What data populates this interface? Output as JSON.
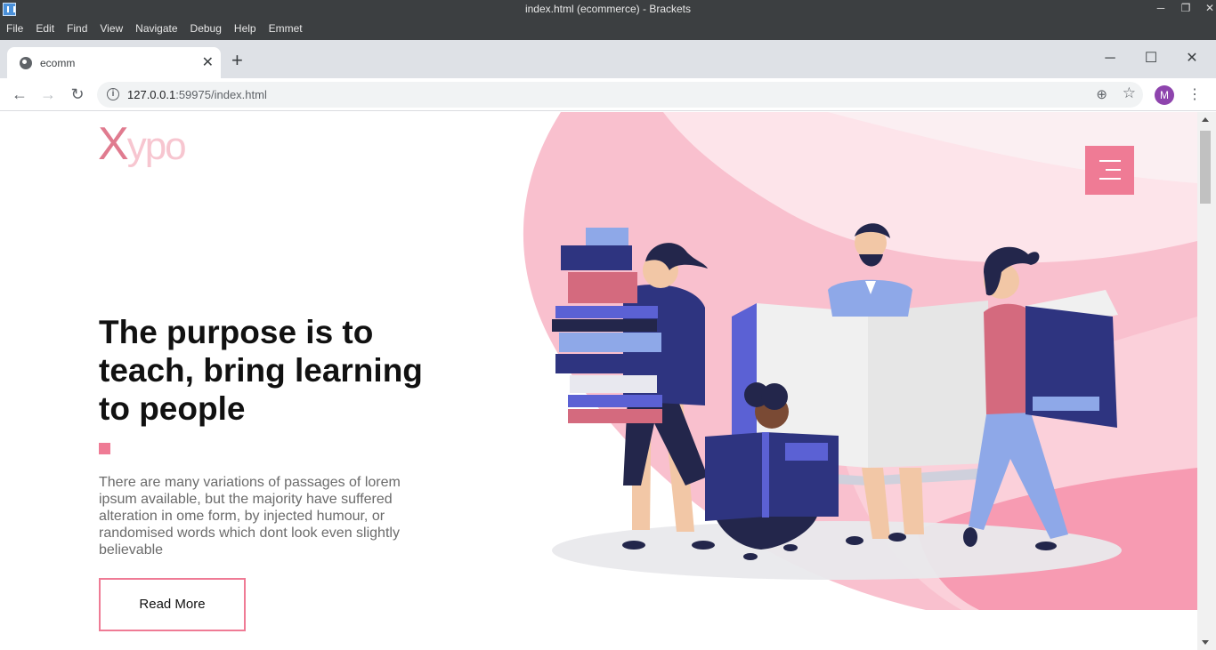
{
  "editor": {
    "window_title": "index.html (ecommerce) - Brackets",
    "menu": [
      "File",
      "Edit",
      "Find",
      "View",
      "Navigate",
      "Debug",
      "Help",
      "Emmet"
    ],
    "window_controls": {
      "minimize": "─",
      "restore": "❐",
      "close": "✕"
    }
  },
  "browser": {
    "tab_title": "ecomm",
    "tab_close": "✕",
    "new_tab": "+",
    "url_host": "127.0.0.1",
    "url_path": ":59975/index.html",
    "profile_initial": "M",
    "window_controls": {
      "minimize": "─",
      "maximize": "☐",
      "close": "✕"
    }
  },
  "page": {
    "logo_x": "X",
    "logo_rest": "ypo",
    "hero_title": "The purpose is to teach, bring learning to people",
    "hero_description": "There are many variations of passages of lorem ipsum available, but the majority have suffered alteration in ome form, by injected humour, or randomised words which dont look even slightly believable",
    "cta_label": "Read More",
    "colors": {
      "accent": "#ef7b95",
      "logo_pink": "#e07b8f",
      "logo_light": "#f7c6d0",
      "navy": "#2e3480",
      "periwinkle": "#8ea8e8"
    }
  }
}
